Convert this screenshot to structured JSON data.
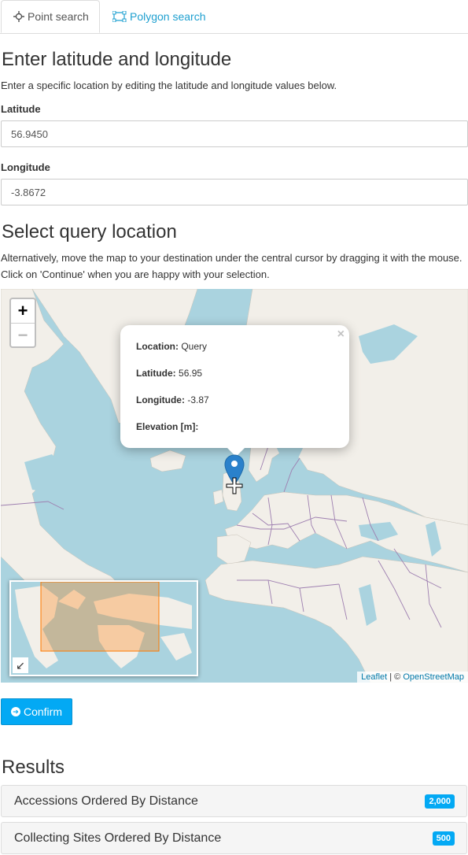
{
  "tabs": {
    "point": "Point search",
    "polygon": "Polygon search"
  },
  "manual": {
    "heading": "Enter latitude and longitude",
    "description": "Enter a specific location by editing the latitude and longitude values below.",
    "latitude_label": "Latitude",
    "latitude_value": "56.9450",
    "longitude_label": "Longitude",
    "longitude_value": "-3.8672"
  },
  "map_section": {
    "heading": "Select query location",
    "description": "Alternatively, move the map to your destination under the central cursor by dragging it with the mouse. Click on 'Continue' when you are happy with your selection."
  },
  "map": {
    "zoom_in": "+",
    "zoom_out": "−",
    "popup": {
      "location_label": "Location:",
      "location_value": "Query",
      "latitude_label": "Latitude:",
      "latitude_value": "56.95",
      "longitude_label": "Longitude:",
      "longitude_value": "-3.87",
      "elevation_label": "Elevation [m]:",
      "close": "×"
    },
    "attribution_leaflet": "Leaflet",
    "attribution_sep": " | © ",
    "attribution_osm": "OpenStreetMap",
    "minimap_toggle": "↙",
    "colors": {
      "water": "#aad3df",
      "land": "#f2efe9",
      "border": "#9e7fb0",
      "marker": "#2a81cb"
    }
  },
  "confirm": {
    "label": "Confirm",
    "icon": "arrow-circle-right-icon"
  },
  "results": {
    "heading": "Results",
    "items": [
      {
        "label": "Accessions Ordered By Distance",
        "count": "2,000"
      },
      {
        "label": "Collecting Sites Ordered By Distance",
        "count": "500"
      }
    ]
  },
  "accent_color": "#03a9f4"
}
